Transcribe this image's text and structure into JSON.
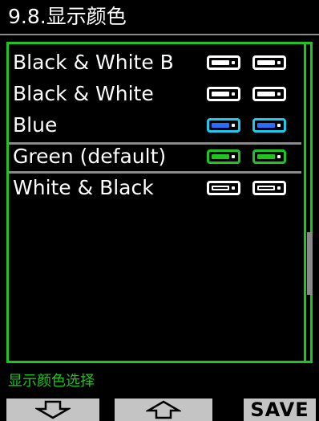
{
  "header": {
    "title": "9.8.显示颜色"
  },
  "list": {
    "items": [
      {
        "label": "Black & White B",
        "frame_color": "#ffffff",
        "fill_color": "#ffffff",
        "dot_color": "#ffffff",
        "selected": false
      },
      {
        "label": "Black & White",
        "frame_color": "#ffffff",
        "fill_color": "#ffffff",
        "dot_color": "#ffffff",
        "selected": false
      },
      {
        "label": "Blue",
        "frame_color": "#1ec8f0",
        "fill_color": "#2a6cff",
        "dot_color": "#ffffff",
        "selected": false
      },
      {
        "label": "Green (default)",
        "frame_color": "#1ec51e",
        "fill_color": "#1ec51e",
        "dot_color": "#ffffff",
        "selected": true
      },
      {
        "label": "White & Black",
        "frame_color": "#ffffff",
        "fill_color": "#000000",
        "dot_color": "#ffffff",
        "selected": false
      }
    ]
  },
  "footer": {
    "caption": "显示颜色选择",
    "save_label": "SAVE"
  },
  "colors": {
    "accent": "#1ec51e",
    "softkey": "#c4c4c4",
    "divider": "#8a8a8a"
  }
}
